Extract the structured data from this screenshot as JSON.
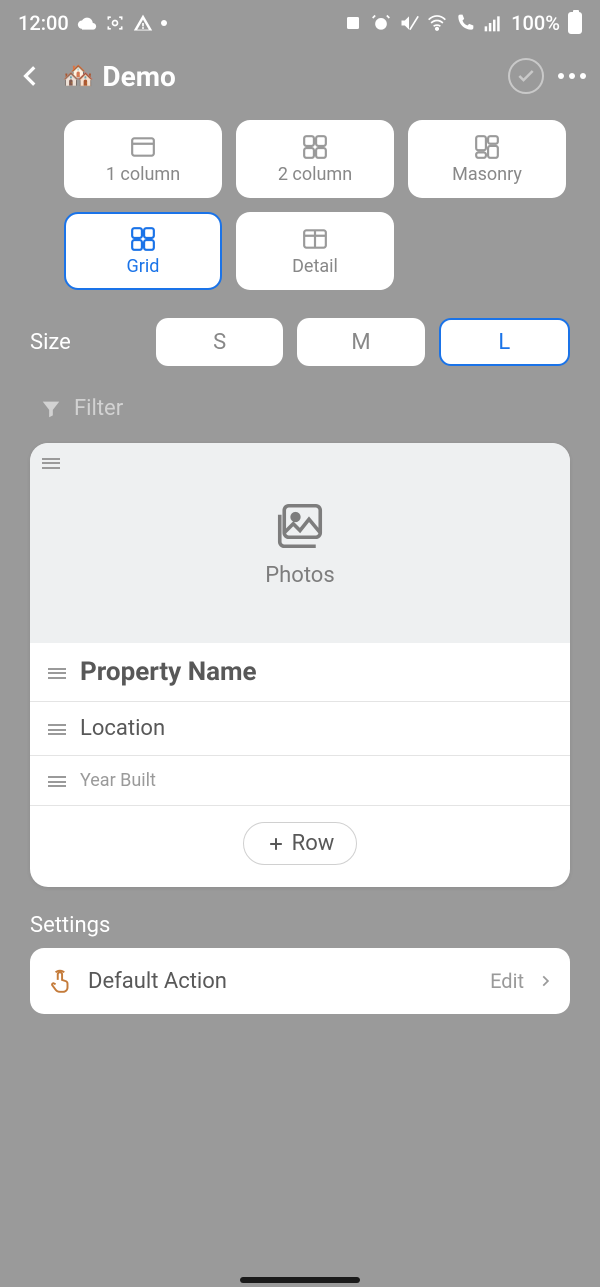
{
  "statusbar": {
    "time": "12:00",
    "battery": "100%"
  },
  "header": {
    "title": "Demo"
  },
  "layouts": [
    {
      "key": "one-column",
      "label": "1 column",
      "selected": false
    },
    {
      "key": "two-column",
      "label": "2 column",
      "selected": false
    },
    {
      "key": "masonry",
      "label": "Masonry",
      "selected": false
    },
    {
      "key": "grid",
      "label": "Grid",
      "selected": true
    },
    {
      "key": "detail",
      "label": "Detail",
      "selected": false
    }
  ],
  "size": {
    "label": "Size",
    "options": [
      "S",
      "M",
      "L"
    ],
    "selected": "L"
  },
  "filter_label": "Filter",
  "preview": {
    "media_label": "Photos",
    "rows": [
      "Property Name",
      "Location",
      "Year Built"
    ],
    "add_row_label": "Row"
  },
  "settings": {
    "heading": "Settings",
    "default_action_label": "Default Action",
    "default_action_value": "Edit"
  }
}
